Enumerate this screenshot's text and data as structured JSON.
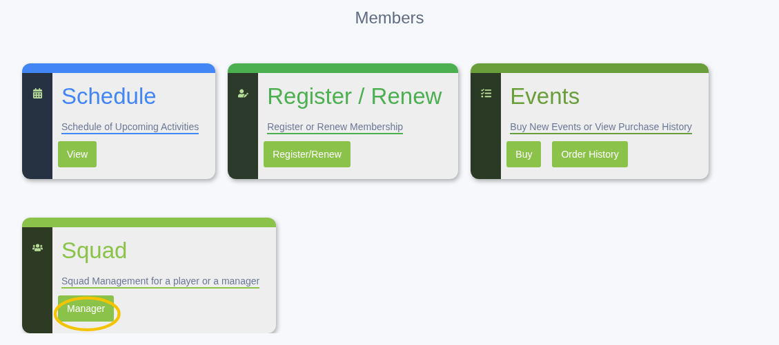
{
  "page_title": "Members",
  "cards": [
    {
      "kind": "calendar",
      "title": "Schedule",
      "link": "Schedule of Upcoming Activities",
      "color": "#4285f4",
      "buttons": [
        "View"
      ],
      "annotated": false
    },
    {
      "kind": "user-edit",
      "title": "Register / Renew",
      "link": "Register or Renew Membership",
      "color": "#4caf50",
      "buttons": [
        "Register/Renew"
      ],
      "annotated": false
    },
    {
      "kind": "tasks",
      "title": "Events",
      "link": "Buy New Events or View Purchase History",
      "color": "#6a9e3a",
      "buttons": [
        "Buy",
        "Order History"
      ],
      "annotated": false
    },
    {
      "kind": "users",
      "title": "Squad",
      "link": "Squad Management for a player or a manager",
      "color": "#8bc34a",
      "buttons": [
        "Manager"
      ],
      "annotated": true
    }
  ]
}
